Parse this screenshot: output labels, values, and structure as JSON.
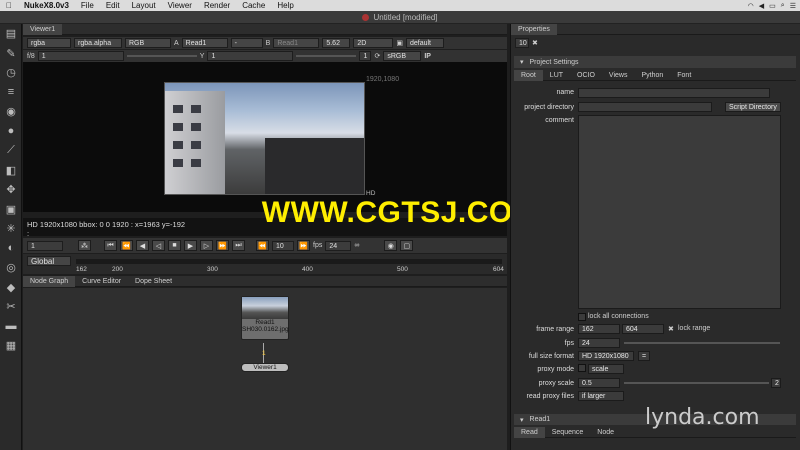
{
  "menubar": {
    "app": "NukeX8.0v3",
    "items": [
      "File",
      "Edit",
      "Layout",
      "Viewer",
      "Render",
      "Cache",
      "Help"
    ]
  },
  "window_title": "Untitled [modified]",
  "viewer": {
    "tab": "Viewer1",
    "channels": "rgba",
    "alpha": "rgba.alpha",
    "colorspace": "RGB",
    "input_a_label": "A",
    "input_a": "Read1",
    "input_a_op": "-",
    "input_b_label": "B",
    "input_b": "Read1",
    "zoom": "5.62",
    "view_mode": "2D",
    "lut": "default",
    "fstop": "f/8",
    "gain": "1",
    "gamma_label": "Y",
    "gamma": "1",
    "viewer_lut": "sRGB",
    "ip_label": "IP",
    "frame_count": "1",
    "format_overlay": "1920,1080",
    "hd_label": "HD",
    "info_line": "HD 1920x1080  bbox: 0 0 1920 :  x=1963 y=-192",
    "info_line_2": ":"
  },
  "watermark": "WWW.CGTSJ.COM",
  "transport": {
    "frame": "1",
    "increment": "10",
    "fps_label": "fps",
    "fps": "24"
  },
  "timeline": {
    "range_mode": "Global",
    "ticks": [
      "162",
      "200",
      "300",
      "400",
      "500",
      "604"
    ]
  },
  "nodegraph": {
    "tabs": [
      "Node Graph",
      "Curve Editor",
      "Dope Sheet"
    ],
    "read_node_label": "Read1",
    "read_node_file": "SH030.0162.jpg",
    "connector_label": "1",
    "viewer_node_label": "Viewer1"
  },
  "properties": {
    "tab": "Properties",
    "max_panels": "10",
    "panel_title": "Project Settings",
    "subtabs": [
      "Root",
      "LUT",
      "OCIO",
      "Views",
      "Python",
      "Font"
    ],
    "name_label": "name",
    "name_value": "",
    "project_directory_label": "project directory",
    "project_directory_value": "",
    "script_directory_button": "Script Directory",
    "comment_label": "comment",
    "comment_value": "",
    "lock_connections": "lock all connections",
    "frame_range_label": "frame range",
    "frame_start": "162",
    "frame_end": "604",
    "lock_range": "lock range",
    "fps_label": "fps",
    "fps_value": "24",
    "full_size_format_label": "full size format",
    "full_size_format_value": "HD 1920x1080",
    "proxy_mode_label": "proxy mode",
    "proxy_mode_value": "scale",
    "proxy_scale_label": "proxy scale",
    "proxy_scale_value": "0.5",
    "proxy_scale_slider_end": "2",
    "read_proxy_files_label": "read proxy files",
    "read_proxy_files_value": "if larger",
    "read_panel_title": "Read1",
    "read_subtabs": [
      "Read",
      "Sequence",
      "Node"
    ]
  },
  "lynda": "lynda.com"
}
